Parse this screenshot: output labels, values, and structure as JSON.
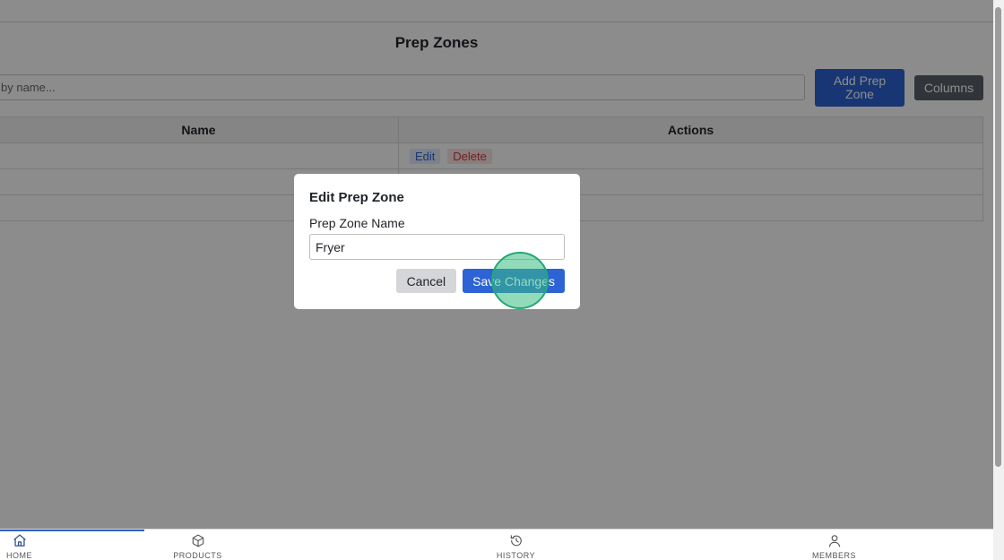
{
  "page": {
    "title": "Prep Zones",
    "search_placeholder": "Search by name...",
    "search_value_visible": "by name...",
    "add_button_label": "Add Prep Zone",
    "columns_button_label": "Columns"
  },
  "table": {
    "headers": [
      "Name",
      "Actions"
    ],
    "row_actions": {
      "edit": "Edit",
      "delete": "Delete"
    }
  },
  "modal": {
    "title": "Edit Prep Zone",
    "field_label": "Prep Zone Name",
    "field_value": "Fryer",
    "cancel_label": "Cancel",
    "save_label": "Save Changes"
  },
  "bottom_nav": {
    "items": [
      {
        "icon": "home-icon",
        "label": "HOME"
      },
      {
        "icon": "box-icon",
        "label": "PRODUCTS"
      },
      {
        "icon": "history-icon",
        "label": "HISTORY"
      },
      {
        "icon": "user-icon",
        "label": "MEMBERS"
      }
    ]
  },
  "colors": {
    "primary": "#2d63d4",
    "secondary": "#5a6168",
    "danger": "#d23b3b",
    "click_highlight": "#23a874"
  }
}
